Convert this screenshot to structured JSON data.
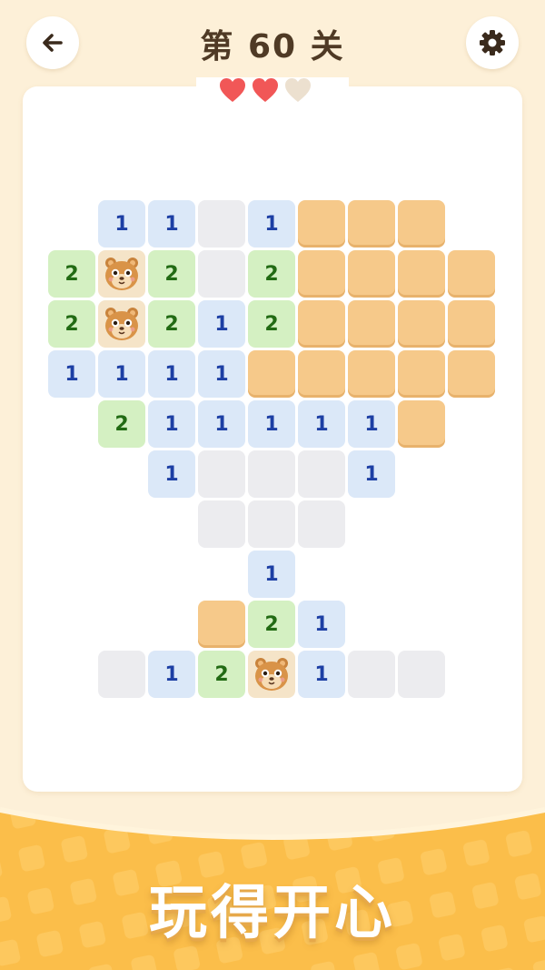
{
  "header": {
    "title": "第 60 关",
    "back_icon": "arrow-left-icon",
    "settings_icon": "gear-icon"
  },
  "lives": {
    "total": 3,
    "remaining": 2
  },
  "colors": {
    "heart_full": "#f15757",
    "heart_empty": "#ece0cf",
    "number_one": "#1d3fa4",
    "number_two": "#226b14",
    "hidden_tile": "#f6c98a",
    "background": "#fdf0d8"
  },
  "grid": {
    "columns": 9,
    "rows": 10,
    "cells": [
      [
        null,
        "1",
        "1",
        "E",
        "1",
        "H",
        "H",
        "H",
        null
      ],
      [
        "2",
        "B",
        "2",
        "E",
        "2",
        "H",
        "H",
        "H",
        "H"
      ],
      [
        "2",
        "B",
        "2",
        "1",
        "2",
        "H",
        "H",
        "H",
        "H"
      ],
      [
        "1",
        "1",
        "1",
        "1",
        "H",
        "H",
        "H",
        "H",
        "H"
      ],
      [
        null,
        "2",
        "1",
        "1",
        "1",
        "1",
        "1",
        "H",
        null
      ],
      [
        null,
        null,
        "1",
        "E",
        "E",
        "E",
        "1",
        null,
        null
      ],
      [
        null,
        null,
        null,
        "E",
        "E",
        "E",
        null,
        null,
        null
      ],
      [
        null,
        null,
        null,
        null,
        "1",
        null,
        null,
        null,
        null
      ],
      [
        null,
        null,
        null,
        "H",
        "2",
        "1",
        null,
        null,
        null
      ],
      [
        null,
        "E",
        "1",
        "2",
        "B",
        "1",
        "E",
        "E",
        null
      ]
    ]
  },
  "banner": {
    "text": "玩得开心"
  }
}
